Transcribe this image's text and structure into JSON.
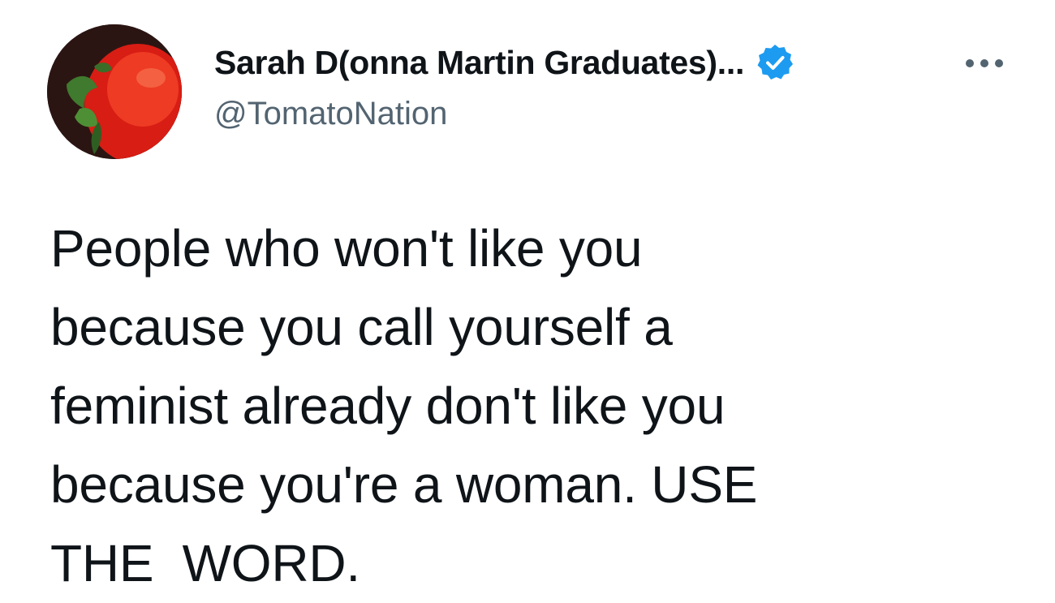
{
  "author": {
    "display_name": "Sarah D(onna Martin Graduates)...",
    "handle": "@TomatoNation",
    "verified": true,
    "avatar_icon": "tomato-avatar-icon",
    "verified_icon": "verified-badge-icon"
  },
  "actions": {
    "more_icon": "more-options-icon"
  },
  "tweet": {
    "text": "People who won't like you\nbecause you call yourself a\nfeminist already don't like you\nbecause you're a woman. USE\nTHE  WORD."
  },
  "colors": {
    "verified_blue": "#1d9bf0",
    "handle_gray": "#536471",
    "text": "#0f1419",
    "tomato_red": "#e0231a"
  }
}
